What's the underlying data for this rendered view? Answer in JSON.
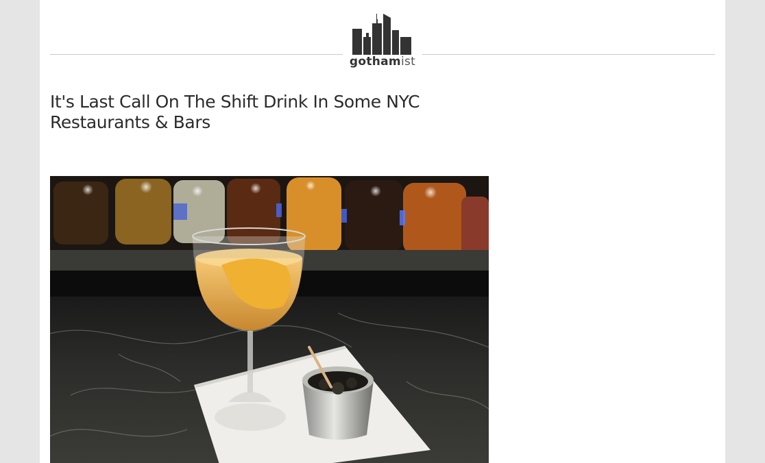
{
  "logo": {
    "icon": "city-skyline-icon",
    "brand_bold": "gotham",
    "brand_light": "ist"
  },
  "article": {
    "headline": "It's Last Call On The Shift Drink In Some NYC Restaurants & Bars",
    "image_subject": "cocktail"
  },
  "colors": {
    "background": "#e5e5e5",
    "page": "#ffffff",
    "logo": "#333333",
    "headline": "#2b2b2b"
  }
}
